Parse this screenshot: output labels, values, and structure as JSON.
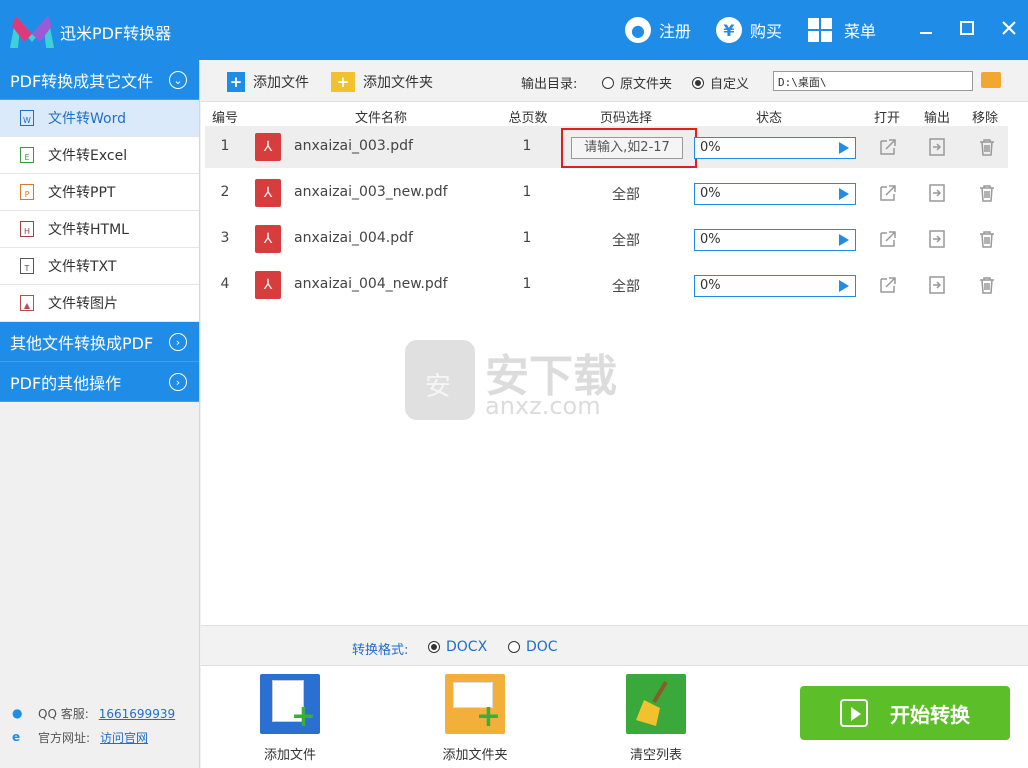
{
  "app": {
    "title": "迅米PDF转换器"
  },
  "titlebar": {
    "register": "注册",
    "buy": "购买",
    "menu": "菜单",
    "buy_symbol": "¥"
  },
  "sidebar": {
    "cat1": "PDF转换成其它文件",
    "items": [
      {
        "label": "文件转Word",
        "icon": "W"
      },
      {
        "label": "文件转Excel",
        "icon": "E"
      },
      {
        "label": "文件转PPT",
        "icon": "P"
      },
      {
        "label": "文件转HTML",
        "icon": "H"
      },
      {
        "label": "文件转TXT",
        "icon": "T"
      },
      {
        "label": "文件转图片",
        "icon": "▲"
      }
    ],
    "cat2": "其他文件转换成PDF",
    "cat3": "PDF的其他操作",
    "qq_label": "QQ 客服:",
    "qq_value": "1661699939",
    "site_label": "官方网址:",
    "site_value": "访问官网"
  },
  "toolbar": {
    "add_file": "添加文件",
    "add_folder": "添加文件夹",
    "output_label": "输出目录:",
    "opt_original": "原文件夹",
    "opt_custom": "自定义",
    "output_path": "D:\\桌面\\"
  },
  "table": {
    "headers": {
      "num": "编号",
      "name": "文件名称",
      "pages": "总页数",
      "page_sel": "页码选择",
      "status": "状态",
      "open": "打开",
      "output": "输出",
      "remove": "移除"
    },
    "rows": [
      {
        "num": "1",
        "name": "anxaizai_003.pdf",
        "pages": "1",
        "page_sel": "",
        "page_placeholder": "请输入,如2-17",
        "status": "0%",
        "progress": 0
      },
      {
        "num": "2",
        "name": "anxaizai_003_new.pdf",
        "pages": "1",
        "page_sel": "全部",
        "status": "0%",
        "progress": 0
      },
      {
        "num": "3",
        "name": "anxaizai_004.pdf",
        "pages": "1",
        "page_sel": "全部",
        "status": "0%",
        "progress": 0
      },
      {
        "num": "4",
        "name": "anxaizai_004_new.pdf",
        "pages": "1",
        "page_sel": "全部",
        "status": "0%",
        "progress": 0
      }
    ]
  },
  "format": {
    "label": "转换格式:",
    "docx": "DOCX",
    "doc": "DOC"
  },
  "bottom": {
    "add_file": "添加文件",
    "add_folder": "添加文件夹",
    "clear": "清空列表",
    "start": "开始转换"
  },
  "watermark": {
    "text": "安下载",
    "url": "anxz.com",
    "bag_char": "安"
  },
  "colors": {
    "accent": "#1f8de8",
    "start": "#5cbf2a",
    "pdf_red": "#d83d3d",
    "highlight": "#e01e1e"
  }
}
